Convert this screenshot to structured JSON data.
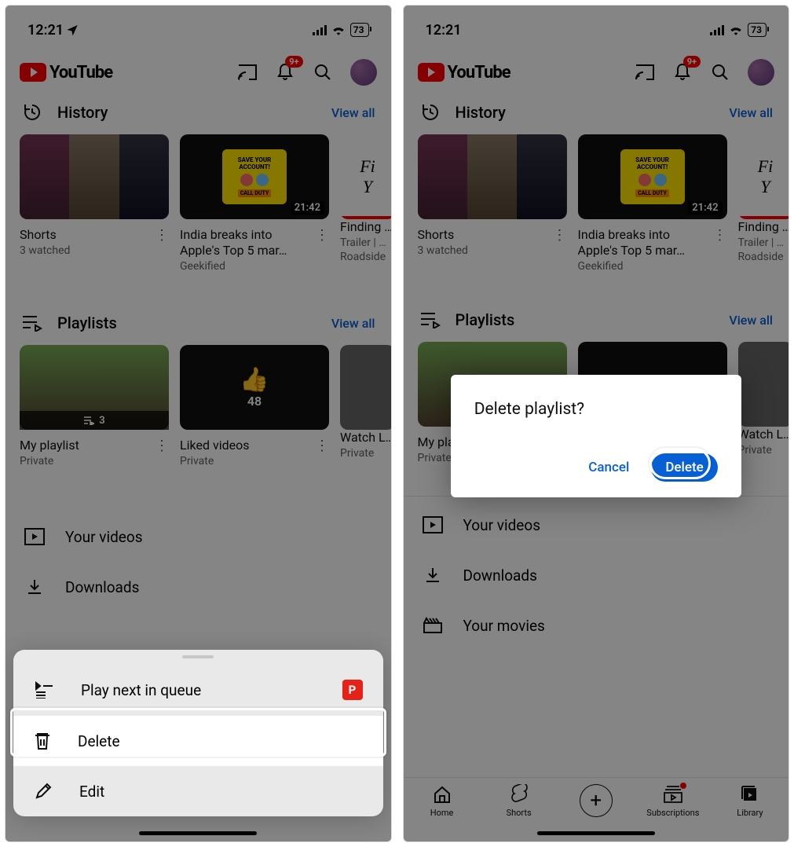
{
  "status": {
    "time": "12:21",
    "battery": "73"
  },
  "header": {
    "brand": "YouTube",
    "notif_badge": "9+"
  },
  "history": {
    "label": "History",
    "view_all": "View all",
    "items": [
      {
        "title": "Shorts",
        "sub": "3 watched"
      },
      {
        "title": "India breaks into Apple's Top 5 mar…",
        "channel": "Geekified",
        "duration": "21:42"
      },
      {
        "title": "Finding …",
        "sub": "Trailer | …",
        "channel": "Roadside"
      }
    ]
  },
  "playlists": {
    "label": "Playlists",
    "view_all": "View all",
    "items": [
      {
        "title": "My playlist",
        "sub": "Private",
        "overlay_count": "3"
      },
      {
        "title": "Liked videos",
        "sub": "Private",
        "like_count": "48"
      },
      {
        "title": "Watch L…",
        "sub": "Private"
      }
    ]
  },
  "library_rows": {
    "your_videos": "Your videos",
    "downloads": "Downloads",
    "your_movies": "Your movies"
  },
  "sheet": {
    "play_next": "Play next in queue",
    "delete": "Delete",
    "edit": "Edit",
    "premium_badge": "P"
  },
  "dialog": {
    "title": "Delete playlist?",
    "cancel": "Cancel",
    "confirm": "Delete"
  },
  "tabs": {
    "home": "Home",
    "shorts": "Shorts",
    "subs": "Subscriptions",
    "library": "Library"
  },
  "promo": {
    "line1": "SAVE YOUR",
    "line2": "ACCOUNT!",
    "line3": "CALL DUTY"
  }
}
